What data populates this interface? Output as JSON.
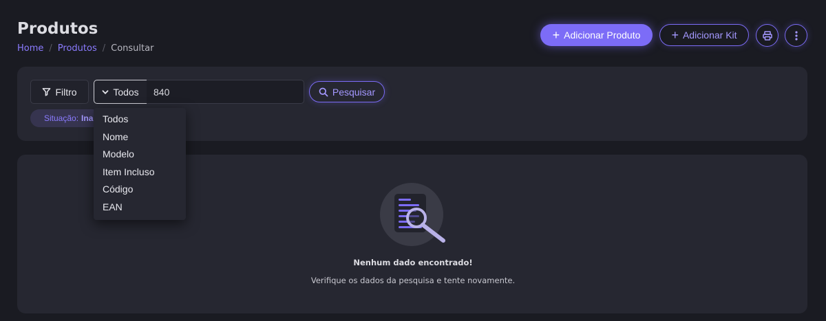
{
  "header": {
    "title": "Produtos",
    "breadcrumb": {
      "home": "Home",
      "section": "Produtos",
      "current": "Consultar",
      "separator": "/"
    },
    "actions": {
      "add_product_label": "Adicionar Produto",
      "add_kit_label": "Adicionar Kit",
      "print_icon": "printer-icon",
      "more_icon": "more-vertical-icon"
    }
  },
  "filter_bar": {
    "filter_label": "Filtro",
    "field_select_value": "Todos",
    "search_value": "840",
    "search_button_label": "Pesquisar",
    "chip": {
      "key": "Situação:",
      "value": "Ina"
    }
  },
  "dropdown": {
    "options": [
      "Todos",
      "Nome",
      "Modelo",
      "Item Incluso",
      "Código",
      "EAN"
    ]
  },
  "empty_state": {
    "title": "Nenhum dado encontrado!",
    "subtitle": "Verifique os dados da pesquisa e tente novamente.",
    "icon": "document-search-icon"
  },
  "colors": {
    "accent": "#7c6cf7",
    "background": "#1a1b22",
    "card": "#262731"
  }
}
